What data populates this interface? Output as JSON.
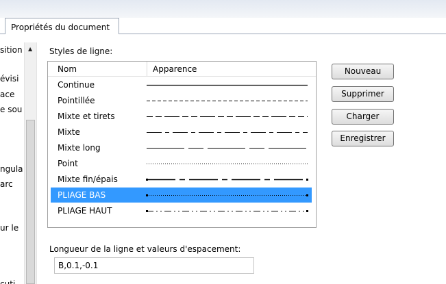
{
  "tab": {
    "title": "Propriétés du document"
  },
  "left_panel": {
    "items": [
      "sition",
      "évisi",
      "ace",
      "e sou",
      "ngula",
      "arc",
      "ur le",
      "cuti"
    ]
  },
  "line_styles": {
    "label": "Styles de ligne:",
    "columns": [
      "Nom",
      "Apparence"
    ],
    "rows": [
      {
        "name": "Continue",
        "pattern": "solid",
        "selected": false
      },
      {
        "name": "Pointillée",
        "pattern": "dashed",
        "selected": false
      },
      {
        "name": "Mixte et tirets",
        "pattern": "mixed-dashes",
        "selected": false
      },
      {
        "name": "Mixte",
        "pattern": "mixed",
        "selected": false
      },
      {
        "name": "Mixte long",
        "pattern": "mixed-long",
        "selected": false
      },
      {
        "name": "Point",
        "pattern": "dotted",
        "selected": false
      },
      {
        "name": "Mixte fin/épais",
        "pattern": "mixed-thin-thick",
        "selected": false
      },
      {
        "name": "PLIAGE BAS",
        "pattern": "fold-low",
        "selected": true
      },
      {
        "name": "PLIAGE HAUT",
        "pattern": "fold-high",
        "selected": false
      }
    ]
  },
  "buttons": {
    "new": "Nouveau",
    "delete": "Supprimer",
    "load": "Charger",
    "save": "Enregistrer"
  },
  "spacing": {
    "label": "Longueur de la ligne et valeurs d'espacement:",
    "value": "B,0.1,-0.1"
  },
  "colors": {
    "selection": "#3399ff",
    "border": "#a0a0a0"
  },
  "icons": {
    "scroll_up": "triangle-up"
  }
}
